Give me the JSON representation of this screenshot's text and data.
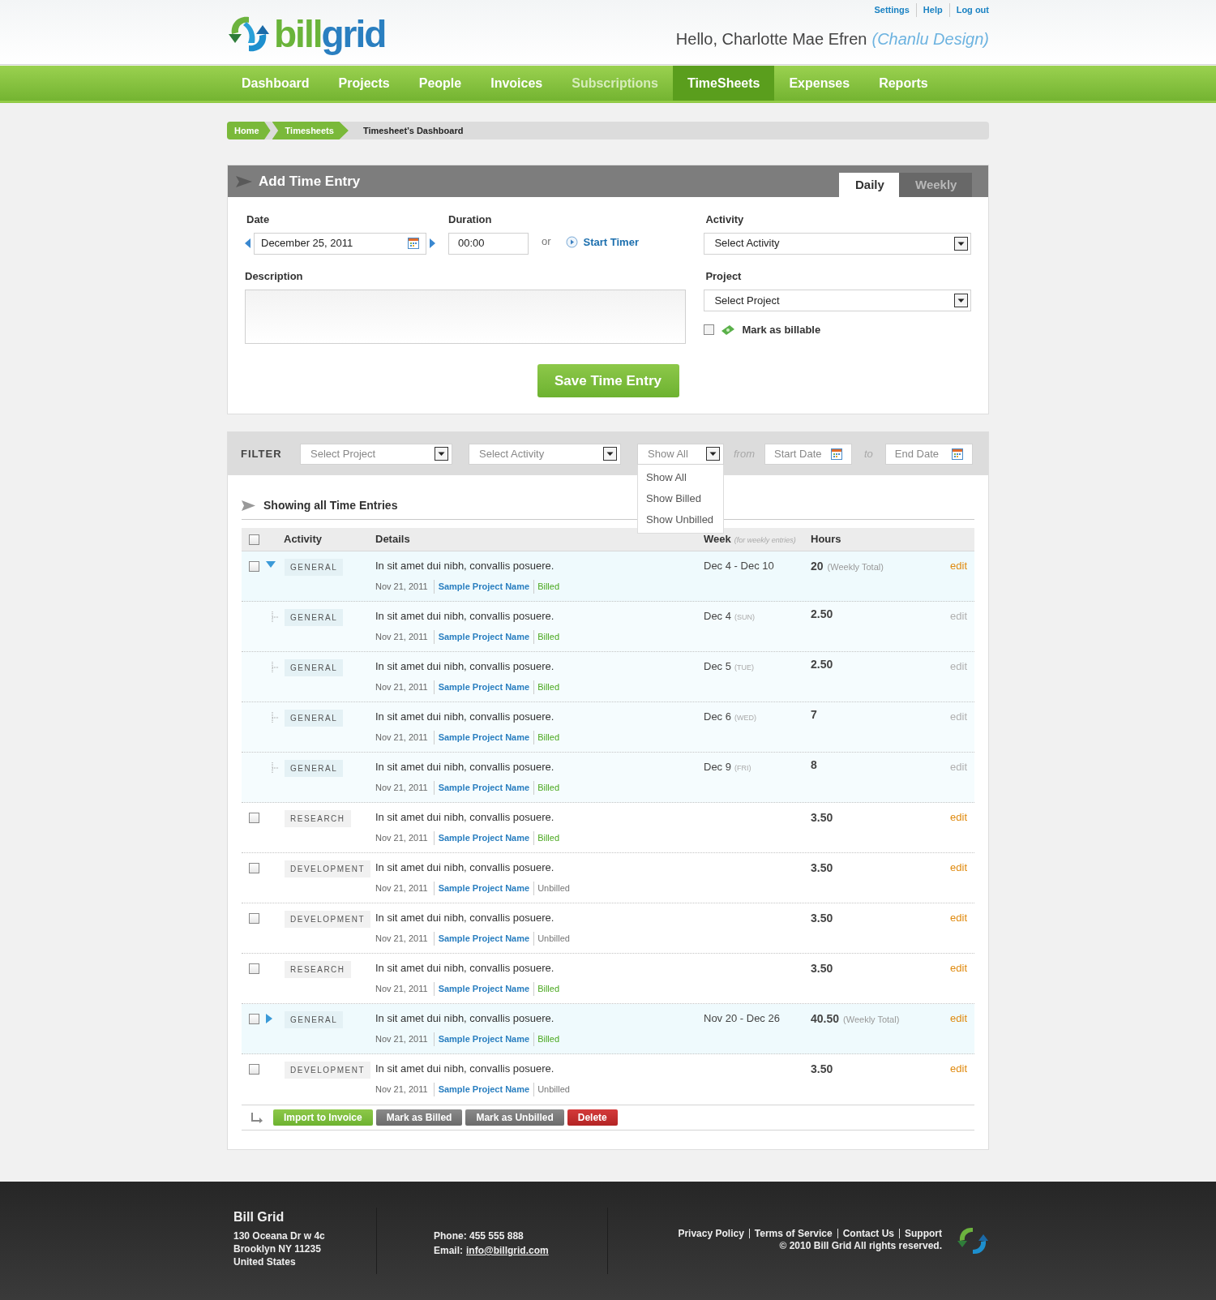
{
  "header": {
    "logo": [
      "bill",
      "grid"
    ],
    "top_links": [
      "Settings",
      "Help",
      "Log out"
    ],
    "greeting": "Hello, Charlotte Mae Efren",
    "company": "(Chanlu Design)"
  },
  "nav": [
    {
      "label": "Dashboard",
      "selected": false,
      "disabled": false
    },
    {
      "label": "Projects",
      "selected": false,
      "disabled": false
    },
    {
      "label": "People",
      "selected": false,
      "disabled": false
    },
    {
      "label": "Invoices",
      "selected": false,
      "disabled": false
    },
    {
      "label": "Subscriptions",
      "selected": false,
      "disabled": true
    },
    {
      "label": "TimeSheets",
      "selected": true,
      "disabled": false
    },
    {
      "label": "Expenses",
      "selected": false,
      "disabled": false
    },
    {
      "label": "Reports",
      "selected": false,
      "disabled": false
    }
  ],
  "breadcrumb": [
    "Home",
    "Timesheets",
    "Timesheet’s Dashboard"
  ],
  "add_entry": {
    "title": "Add Time Entry",
    "tabs": [
      {
        "label": "Daily",
        "selected": true
      },
      {
        "label": "Weekly",
        "selected": false
      }
    ],
    "date_label": "Date",
    "date_value": "December 25, 2011",
    "duration_label": "Duration",
    "duration_value": "00:00",
    "or": "or",
    "start_timer": "Start Timer",
    "description_label": "Description",
    "activity_label": "Activity",
    "activity_value": "Select Activity",
    "project_label": "Project",
    "project_value": "Select Project",
    "billable": {
      "label": "Mark as billable",
      "checked": false
    },
    "save": "Save Time Entry"
  },
  "filter": {
    "label": "FILTER",
    "project": "Select Project",
    "activity": "Select Activity",
    "show": "Show All",
    "from": "from",
    "start": "Start Date",
    "to": "to",
    "end": "End Date",
    "menu": [
      "Show All",
      "Show Billed",
      "Show Unbilled"
    ]
  },
  "listing": {
    "title": "Showing all Time Entries",
    "select_all": {
      "checked": false
    },
    "columns": {
      "activity": "Activity",
      "details": "Details",
      "week": "Week",
      "week_note": "(for weekly entries)",
      "hours": "Hours"
    },
    "rows": [
      {
        "kind": "week",
        "checked": false,
        "expanded": true,
        "activity": "GENERAL",
        "text": "In sit amet dui nibh, convallis posuere.",
        "date": "Nov 21, 2011",
        "project": "Sample Project Name",
        "status": "Billed",
        "billed": true,
        "week": "Dec 4 - Dec 10",
        "hours": "20",
        "hours_note": "(Weekly Total)",
        "edit": "edit",
        "children": [
          {
            "kind": "day",
            "activity": "GENERAL",
            "text": "In sit amet dui nibh, convallis posuere.",
            "date": "Nov 21, 2011",
            "project": "Sample Project Name",
            "status": "Billed",
            "billed": true,
            "week": "Dec 4",
            "day": "(SUN)",
            "hours": "2.50",
            "edit": "edit"
          },
          {
            "kind": "day",
            "activity": "GENERAL",
            "text": "In sit amet dui nibh, convallis posuere.",
            "date": "Nov 21, 2011",
            "project": "Sample Project Name",
            "status": "Billed",
            "billed": true,
            "week": "Dec 5",
            "day": "(TUE)",
            "hours": "2.50",
            "edit": "edit"
          },
          {
            "kind": "day",
            "activity": "GENERAL",
            "text": "In sit amet dui nibh, convallis posuere.",
            "date": "Nov 21, 2011",
            "project": "Sample Project Name",
            "status": "Billed",
            "billed": true,
            "week": "Dec 6",
            "day": "(WED)",
            "hours": "7",
            "edit": "edit"
          },
          {
            "kind": "day",
            "activity": "GENERAL",
            "text": "In sit amet dui nibh, convallis posuere.",
            "date": "Nov 21, 2011",
            "project": "Sample Project Name",
            "status": "Billed",
            "billed": true,
            "week": "Dec 9",
            "day": "(FRI)",
            "hours": "8",
            "edit": "edit"
          }
        ]
      },
      {
        "kind": "entry",
        "checked": false,
        "activity": "RESEARCH",
        "text": "In sit amet dui nibh, convallis posuere.",
        "date": "Nov 21, 2011",
        "project": "Sample Project Name",
        "status": "Billed",
        "billed": true,
        "hours": "3.50",
        "edit": "edit"
      },
      {
        "kind": "entry",
        "checked": false,
        "activity": "DEVELOPMENT",
        "text": "In sit amet dui nibh, convallis posuere.",
        "date": "Nov 21, 2011",
        "project": "Sample Project Name",
        "status": "Unbilled",
        "billed": false,
        "hours": "3.50",
        "edit": "edit"
      },
      {
        "kind": "entry",
        "checked": false,
        "activity": "DEVELOPMENT",
        "text": "In sit amet dui nibh, convallis posuere.",
        "date": "Nov 21, 2011",
        "project": "Sample Project Name",
        "status": "Unbilled",
        "billed": false,
        "hours": "3.50",
        "edit": "edit"
      },
      {
        "kind": "entry",
        "checked": false,
        "activity": "RESEARCH",
        "text": "In sit amet dui nibh, convallis posuere.",
        "date": "Nov 21, 2011",
        "project": "Sample Project Name",
        "status": "Billed",
        "billed": true,
        "hours": "3.50",
        "edit": "edit"
      },
      {
        "kind": "week",
        "checked": false,
        "expanded": false,
        "activity": "GENERAL",
        "text": "In sit amet dui nibh, convallis posuere.",
        "date": "Nov 21, 2011",
        "project": "Sample Project Name",
        "status": "Billed",
        "billed": true,
        "week": "Nov 20 - Dec 26",
        "hours": "40.50",
        "hours_note": "(Weekly Total)",
        "edit": "edit"
      },
      {
        "kind": "entry",
        "checked": false,
        "activity": "DEVELOPMENT",
        "text": "In sit amet dui nibh, convallis posuere.",
        "date": "Nov 21, 2011",
        "project": "Sample Project Name",
        "status": "Unbilled",
        "billed": false,
        "hours": "3.50",
        "edit": "edit"
      }
    ],
    "actions": [
      {
        "label": "Import to Invoice",
        "kind": "primary"
      },
      {
        "label": "Mark as Billed",
        "kind": "neutral"
      },
      {
        "label": "Mark as Unbilled",
        "kind": "neutral"
      },
      {
        "label": "Delete",
        "kind": "danger"
      }
    ]
  },
  "footer": {
    "company": "Bill Grid",
    "address": [
      "130 Oceana Dr w 4c",
      "Brooklyn NY 11235",
      "United States"
    ],
    "phone": "Phone: 455 555 888",
    "email_label": "Email:",
    "email": "info@billgrid.com",
    "links": [
      "Privacy Policy",
      "Terms of Service",
      "Contact Us",
      "Support"
    ],
    "copyright": "© 2010 Bill Grid All rights reserved."
  }
}
